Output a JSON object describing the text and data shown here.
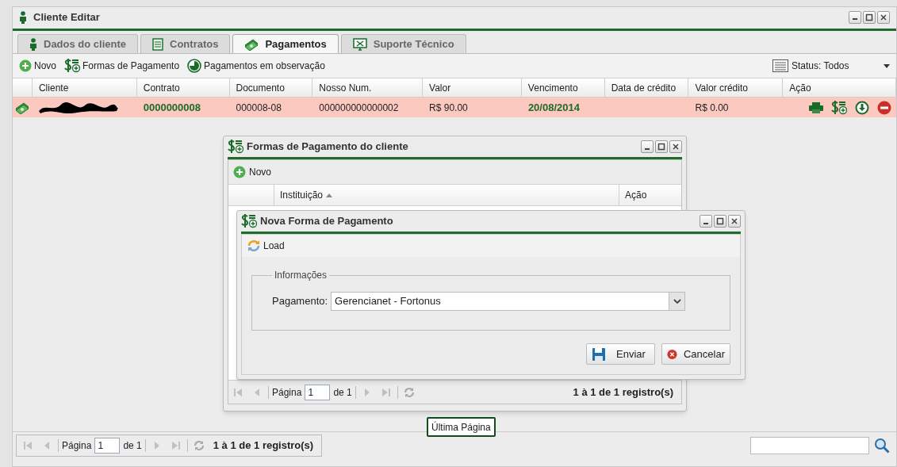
{
  "window": {
    "title": "Cliente Editar"
  },
  "tabs": [
    {
      "label": "Dados do cliente",
      "selected": false
    },
    {
      "label": "Contratos",
      "selected": false
    },
    {
      "label": "Pagamentos",
      "selected": true
    },
    {
      "label": "Suporte Técnico",
      "selected": false
    }
  ],
  "toolbar": [
    "Novo",
    "Formas de Pagamento",
    "Pagamentos em observação"
  ],
  "status_filter": "Status: Todos",
  "table": {
    "columns": [
      "Cliente",
      "Contrato",
      "Documento",
      "Nosso Num.",
      "Valor",
      "Vencimento",
      "Data de crédito",
      "Valor crédito",
      "Ação"
    ],
    "rows": [
      {
        "selected": true,
        "contrato": "0000000008",
        "documento": "000008-08",
        "nosso_num": "000000000000002",
        "valor": "R$ 90.00",
        "vencimento": "20/08/2014",
        "valor_credito": "R$ 0.00"
      }
    ]
  },
  "pager": {
    "page_label": "Página",
    "page": "1",
    "of": "de 1",
    "summary": "1 à 1 de 1 registro(s)"
  },
  "formas_dialog": {
    "title": "Formas de Pagamento do cliente",
    "new_button": "Novo",
    "columns": [
      "Instituição",
      "Ação"
    ],
    "pager": {
      "page_label": "Página",
      "page": "1",
      "of": "de 1",
      "summary": "1 à 1 de 1 registro(s)"
    }
  },
  "nova_dialog": {
    "title": "Nova Forma de Pagamento",
    "load_button": "Load",
    "fieldset": "Informações",
    "field_label": "Pagamento:",
    "field_value": "Gerencianet - Fortonus",
    "buttons": [
      "Enviar",
      "Cancelar"
    ]
  },
  "tooltip": "Última Página"
}
